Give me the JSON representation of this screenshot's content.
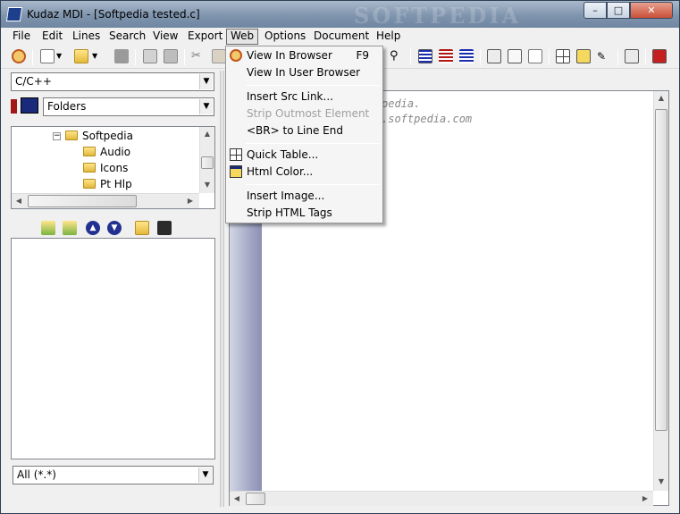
{
  "window": {
    "title": "Kudaz MDI - [Softpedia tested.c]",
    "watermark": "SOFTPEDIA",
    "buttons": {
      "minimize": "–",
      "maximize": "□",
      "close": "✕"
    }
  },
  "menubar": [
    {
      "label": "File"
    },
    {
      "label": "Edit"
    },
    {
      "label": "Lines"
    },
    {
      "label": "Search"
    },
    {
      "label": "View"
    },
    {
      "label": "Export"
    },
    {
      "label": "Web"
    },
    {
      "label": "Options"
    },
    {
      "label": "Document"
    },
    {
      "label": "Help"
    }
  ],
  "left_panel": {
    "language": "C/C++",
    "location": "Folders",
    "tree": [
      {
        "label": "Softpedia",
        "expanded": true
      },
      {
        "label": "Audio"
      },
      {
        "label": "Icons"
      },
      {
        "label": "Pt Hlp"
      }
    ],
    "filter": "All (*.*)"
  },
  "editor": {
    "lines": [
      "pedia.",
      ".softpedia.com"
    ]
  },
  "web_menu": {
    "items": [
      {
        "label": "View In Browser",
        "shortcut": "F9",
        "enabled": true,
        "icon": "browser-icon"
      },
      {
        "label": "View In User Browser",
        "enabled": true
      },
      {
        "label": "Insert Src Link...",
        "enabled": true
      },
      {
        "label": "Strip Outmost Element",
        "enabled": false
      },
      {
        "label": "<BR> to Line End",
        "enabled": true
      },
      {
        "label": "Quick Table...",
        "enabled": true,
        "icon": "table-icon"
      },
      {
        "label": "Html Color...",
        "enabled": true,
        "icon": "color-icon"
      },
      {
        "label": "Insert Image...",
        "enabled": true
      },
      {
        "label": "Strip HTML Tags",
        "enabled": true
      }
    ]
  },
  "colors": {
    "titlebar": "#8497b0",
    "accent": "#1e3f8c",
    "gutter": "#9ea3c2"
  }
}
